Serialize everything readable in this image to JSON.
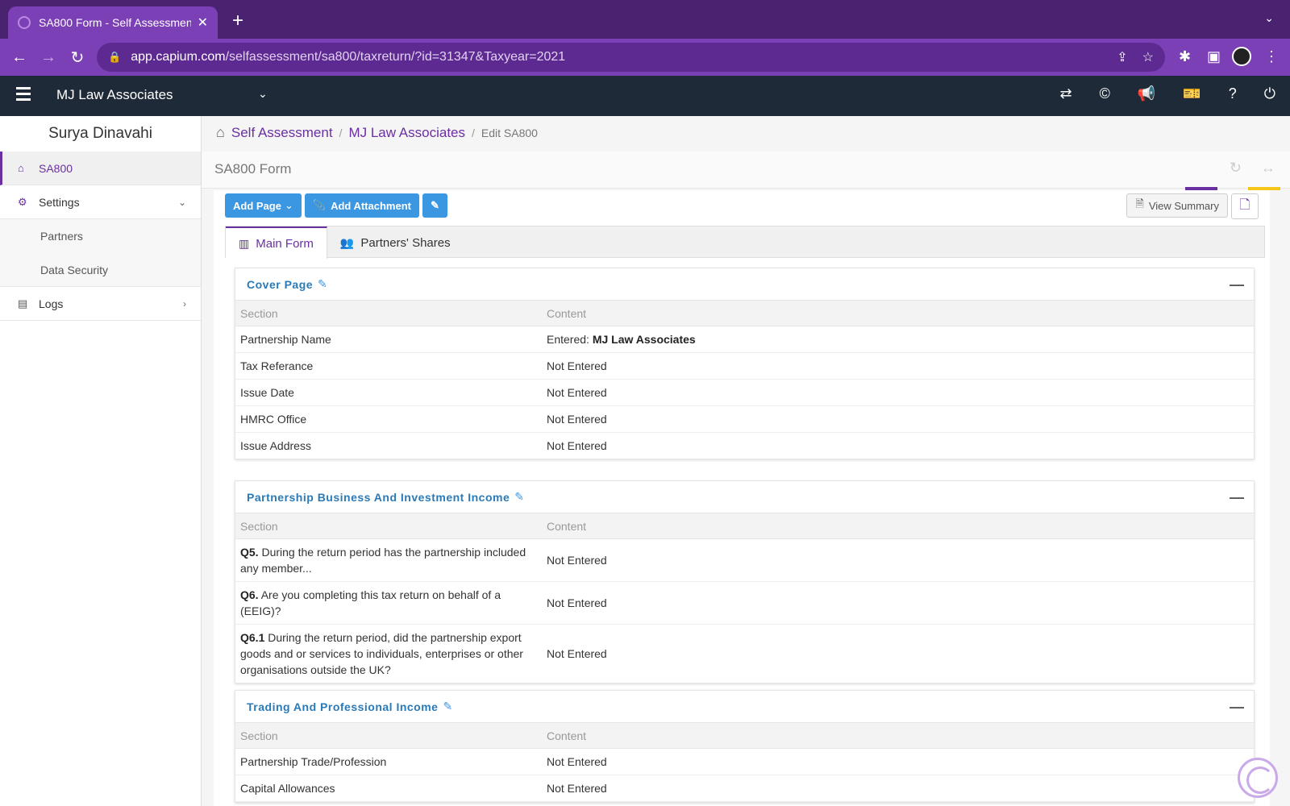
{
  "browser": {
    "tab_title": "SA800 Form - Self Assessment",
    "url_host": "app.capium.com",
    "url_path": "/selfassessment/sa800/taxreturn/?id=31347&Taxyear=2021"
  },
  "header": {
    "company": "MJ Law Associates"
  },
  "sidebar": {
    "user": "Surya Dinavahi",
    "items": [
      {
        "label": "SA800"
      },
      {
        "label": "Settings"
      },
      {
        "label": "Logs"
      }
    ],
    "settings_sub": [
      {
        "label": "Partners"
      },
      {
        "label": "Data Security"
      }
    ]
  },
  "breadcrumb": {
    "items": [
      "Self Assessment",
      "MJ Law Associates"
    ],
    "current": "Edit SA800"
  },
  "page": {
    "form_title": "SA800 Form"
  },
  "actions": {
    "add_page": "Add Page",
    "add_attachment": "Add Attachment",
    "view_summary": "View Summary"
  },
  "tabs": [
    {
      "label": "Main Form"
    },
    {
      "label": "Partners' Shares"
    }
  ],
  "table_headers": {
    "section": "Section",
    "content": "Content"
  },
  "panels": [
    {
      "title": "Cover Page",
      "rows": [
        {
          "section": "Partnership Name",
          "content_prefix": "Entered:",
          "content_bold": "MJ Law Associates"
        },
        {
          "section": "Tax Referance",
          "content": "Not Entered"
        },
        {
          "section": "Issue Date",
          "content": "Not Entered"
        },
        {
          "section": "HMRC Office",
          "content": "Not Entered"
        },
        {
          "section": "Issue Address",
          "content": "Not Entered"
        }
      ]
    },
    {
      "title": "Partnership Business And Investment Income",
      "rows": [
        {
          "q": "Q5.",
          "section": "During the return period has the partnership included any member...",
          "content": "Not Entered"
        },
        {
          "q": "Q6.",
          "section": "Are you completing this tax return on behalf of a (EEIG)?",
          "content": "Not Entered"
        },
        {
          "q": "Q6.1",
          "section": "During the return period, did the partnership export goods and or services to individuals, enterprises or other organisations outside the UK?",
          "content": "Not Entered"
        }
      ]
    },
    {
      "title": "Trading And Professional Income",
      "rows": [
        {
          "section": "Partnership Trade/Profession",
          "content": "Not Entered"
        },
        {
          "section": "Capital Allowances",
          "content": "Not Entered"
        }
      ]
    }
  ],
  "colors": {
    "brand_purple": "#6a2fa0",
    "button_blue": "#3c97e3",
    "appbar": "#1f2a38"
  }
}
